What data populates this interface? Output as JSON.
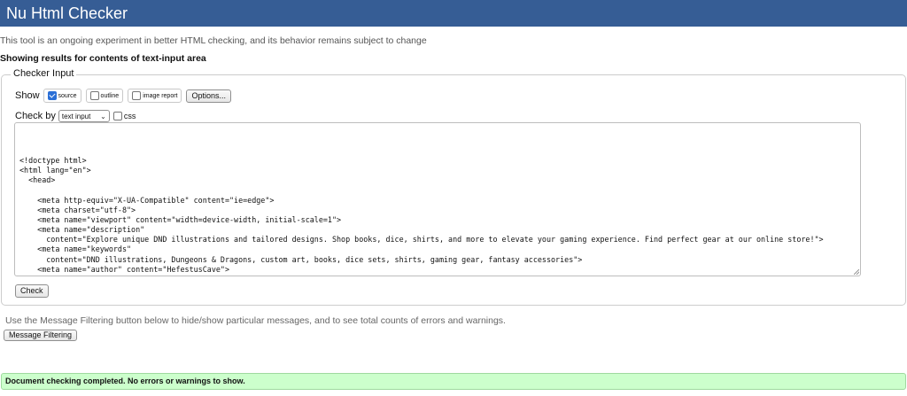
{
  "header": {
    "title": "Nu Html Checker"
  },
  "tagline": "This tool is an ongoing experiment in better HTML checking, and its behavior remains subject to change",
  "results_heading": "Showing results for contents of text-input area",
  "checker_input": {
    "legend": "Checker Input",
    "show_label": "Show",
    "show_options": [
      {
        "label": "source",
        "checked": true
      },
      {
        "label": "outline",
        "checked": false
      },
      {
        "label": "image report",
        "checked": false
      }
    ],
    "options_button": "Options...",
    "check_by_label": "Check by",
    "check_by_selected": "text input",
    "css_label": "css",
    "css_checked": false,
    "code_lines": [
      "",
      "",
      "<!doctype html>",
      "<html lang=\"en\">",
      "  <head>",
      "",
      "    <meta http-equiv=\"X-UA-Compatible\" content=\"ie=edge\">",
      "    <meta charset=\"utf-8\">",
      "    <meta name=\"viewport\" content=\"width=device-width, initial-scale=1\">",
      "    <meta name=\"description\"",
      "      content=\"Explore unique DND illustrations and tailored designs. Shop books, dice, shirts, and more to elevate your gaming experience. Find perfect gear at our online store!\">",
      "    <meta name=\"keywords\"",
      "      content=\"DND illustrations, Dungeons & Dragons, custom art, books, dice sets, shirts, gaming gear, fantasy accessories\">",
      "    <meta name=\"author\" content=\"HefestusCave\">"
    ],
    "check_button": "Check"
  },
  "filter_note": "Use the Message Filtering button below to hide/show particular messages, and to see total counts of errors and warnings.",
  "filter_button": "Message Filtering",
  "result_message": "Document checking completed. No errors or warnings to show.",
  "colors": {
    "header_bg": "#365d95",
    "success_bg": "#ccffcc"
  }
}
